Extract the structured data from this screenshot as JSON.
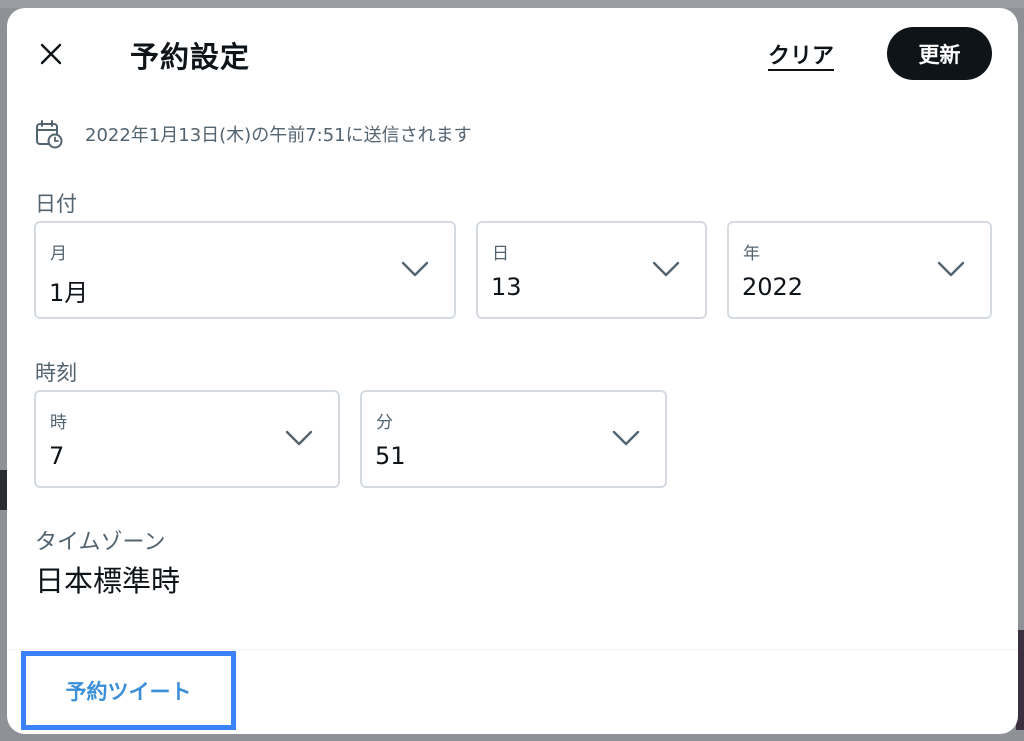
{
  "header": {
    "title": "予約設定",
    "clear_label": "クリア",
    "update_label": "更新"
  },
  "schedule_info": {
    "text": "2022年1月13日(木)の午前7:51に送信されます"
  },
  "date": {
    "section_label": "日付",
    "month": {
      "label": "月",
      "value": "1月"
    },
    "day": {
      "label": "日",
      "value": "13"
    },
    "year": {
      "label": "年",
      "value": "2022"
    }
  },
  "time": {
    "section_label": "時刻",
    "hour": {
      "label": "時",
      "value": "7"
    },
    "minute": {
      "label": "分",
      "value": "51"
    }
  },
  "timezone": {
    "label": "タイムゾーン",
    "value": "日本標準時"
  },
  "footer": {
    "scheduled_tweets_label": "予約ツイート"
  },
  "icons": {
    "close": "close-icon",
    "calendar": "calendar-clock-icon",
    "chevron": "chevron-down-icon"
  },
  "colors": {
    "primary_text": "#0f1419",
    "secondary_text": "#536471",
    "border": "#d5dbe0",
    "link_blue": "#3b8fd8",
    "highlight_border": "#3b82f6",
    "update_button_bg": "#0f1419"
  }
}
